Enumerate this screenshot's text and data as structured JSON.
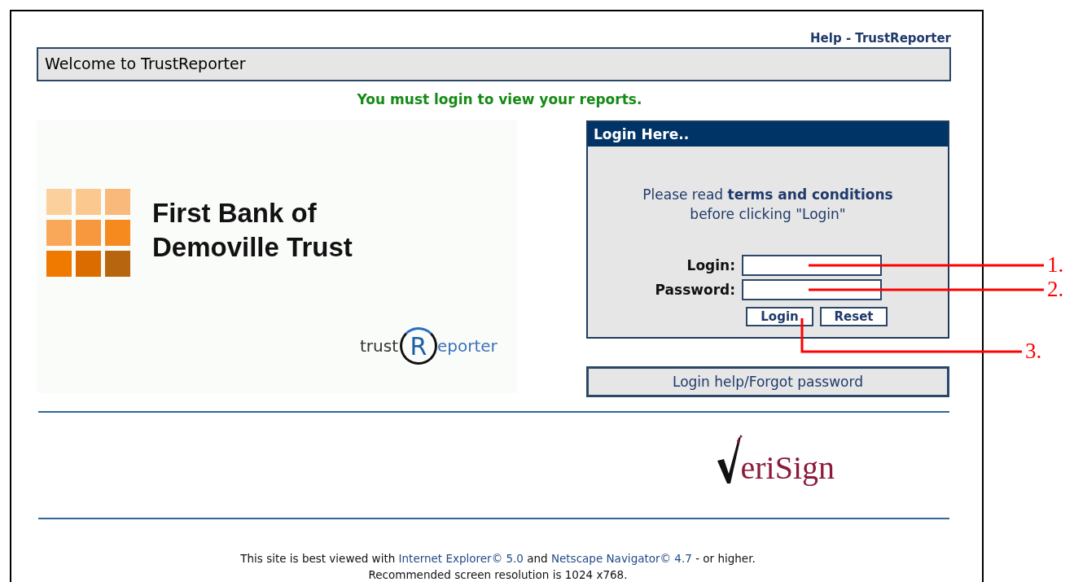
{
  "header": {
    "help_link": "Help - TrustReporter",
    "title": "Welcome to TrustReporter",
    "notice": "You must login to view your reports."
  },
  "bank_logo": {
    "name_lines": [
      "First Bank of",
      "Demoville Trust"
    ]
  },
  "product_logo": {
    "parts": [
      "trust",
      "R",
      "eporter"
    ]
  },
  "login_panel": {
    "title": "Login Here..",
    "note_lines": [
      "Please read **terms and conditions**",
      "before clicking \"Login\""
    ],
    "fields": [
      {
        "label": "Login:"
      },
      {
        "label": "Password:"
      }
    ],
    "buttons": [
      "Login",
      "Reset"
    ]
  },
  "help_button": "Login help/Forgot password",
  "verisign_logo": {
    "text": "eriSign"
  },
  "footer": {
    "line_1": [
      {
        "kind": "text",
        "text": "This site is best viewed with "
      },
      {
        "kind": "link",
        "text": "Internet Explorer© 5.0"
      },
      {
        "kind": "text",
        "text": " and "
      },
      {
        "kind": "link",
        "text": "Netscape Navigator© 4.7"
      },
      {
        "kind": "text",
        "text": " - or higher."
      }
    ],
    "line_2": "Recommended screen resolution is 1024 x768."
  },
  "callouts": [
    {
      "label": "1.",
      "kind": "field"
    },
    {
      "label": "2.",
      "kind": "field"
    },
    {
      "label": "3.",
      "kind": "button"
    }
  ]
}
